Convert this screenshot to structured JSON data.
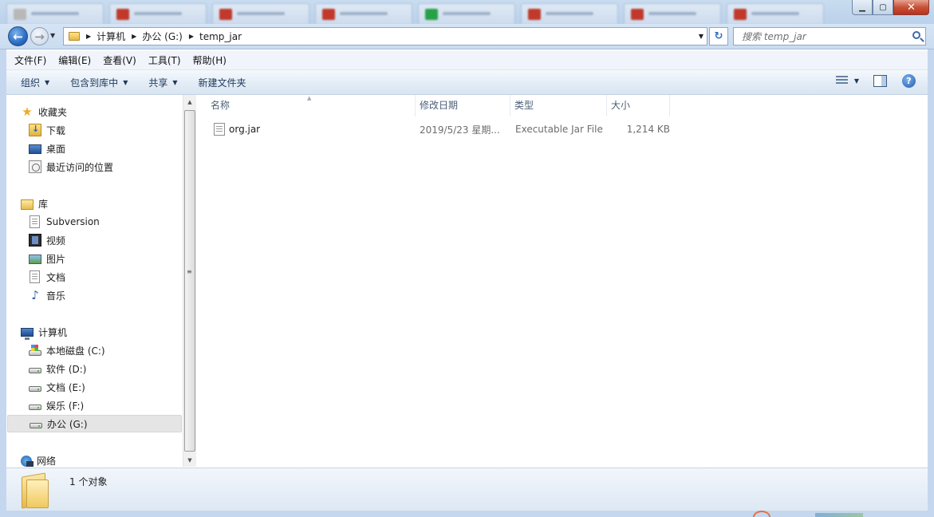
{
  "window": {
    "min_glyph": "▁",
    "max_glyph": "▢",
    "close_glyph": "✕"
  },
  "background_tabs": [
    {
      "icon_color": "#b8b8b8"
    },
    {
      "icon_color": "#c0392b"
    },
    {
      "icon_color": "#c0392b"
    },
    {
      "icon_color": "#c0392b"
    },
    {
      "icon_color": "#27a048"
    },
    {
      "icon_color": "#c0392b"
    },
    {
      "icon_color": "#c0392b"
    },
    {
      "icon_color": "#c0392b"
    }
  ],
  "address": {
    "crumbs": [
      "计算机",
      "办公 (G:)",
      "temp_jar"
    ]
  },
  "search": {
    "placeholder": "搜索 temp_jar"
  },
  "menu": [
    "文件(F)",
    "编辑(E)",
    "查看(V)",
    "工具(T)",
    "帮助(H)"
  ],
  "commands": [
    {
      "label": "组织",
      "dropdown": true
    },
    {
      "label": "包含到库中",
      "dropdown": true
    },
    {
      "label": "共享",
      "dropdown": true
    },
    {
      "label": "新建文件夹",
      "dropdown": false
    }
  ],
  "nav": {
    "favorites": {
      "label": "收藏夹",
      "items": [
        "下载",
        "桌面",
        "最近访问的位置"
      ]
    },
    "libraries": {
      "label": "库",
      "items": [
        "Subversion",
        "视频",
        "图片",
        "文档",
        "音乐"
      ]
    },
    "computer": {
      "label": "计算机",
      "items": [
        "本地磁盘 (C:)",
        "软件 (D:)",
        "文档 (E:)",
        "娱乐 (F:)",
        "办公 (G:)"
      ],
      "selected": "办公 (G:)"
    },
    "network": {
      "label": "网络"
    }
  },
  "columns": [
    "名称",
    "修改日期",
    "类型",
    "大小"
  ],
  "files": [
    {
      "name": "org.jar",
      "modified": "2019/5/23 星期...",
      "type": "Executable Jar File",
      "size": "1,214 KB"
    }
  ],
  "details": {
    "count": "1 个对象"
  },
  "colors": {
    "accent": "#2a6cc4",
    "title_bg": "#c9dcef"
  }
}
